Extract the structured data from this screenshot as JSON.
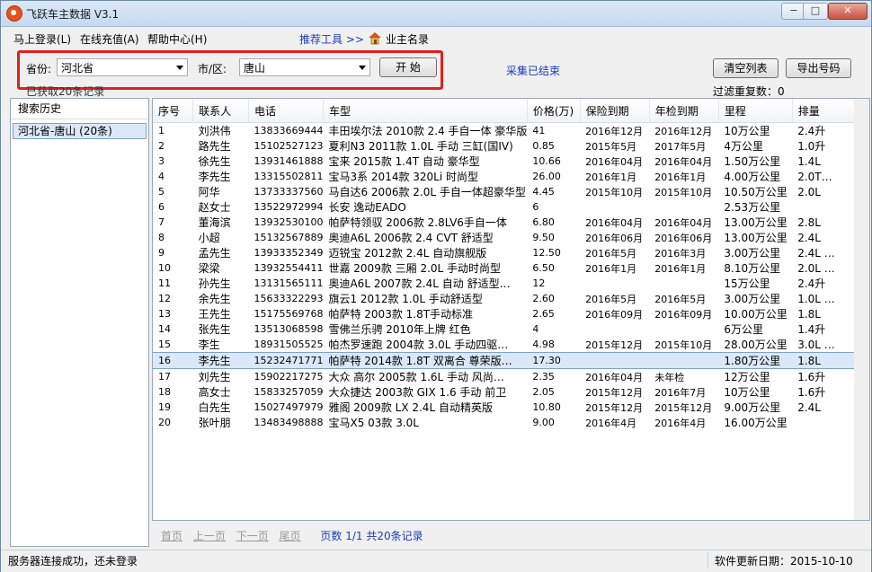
{
  "window": {
    "title": "飞跃车主数据 V3.1",
    "btn_min": "−",
    "btn_max": "□",
    "btn_close": "✕"
  },
  "menu": {
    "items": [
      "马上登录(L)",
      "在线充值(A)",
      "帮助中心(H)"
    ],
    "tools_link": "推荐工具 >>",
    "owners_list": "业主名录"
  },
  "filters": {
    "province_label": "省份:",
    "province_value": "河北省",
    "city_label": "市/区:",
    "city_value": "唐山",
    "start_button": "开 始",
    "collect_status": "采集已结束",
    "clear_button": "清空列表",
    "export_button": "导出号码",
    "got_records": "已获取20条记录",
    "dedup": "过滤重复数：0"
  },
  "sidebar": {
    "header": "搜索历史",
    "items": [
      "河北省-唐山 (20条)"
    ]
  },
  "table": {
    "columns": [
      "序号",
      "联系人",
      "电话",
      "车型",
      "价格(万)",
      "保险到期",
      "年检到期",
      "里程",
      "排量"
    ],
    "rows": [
      [
        "1",
        "刘洪伟",
        "13833669444",
        "丰田埃尔法 2010款 2.4 手自一体 豪华版",
        "41",
        "2016年12月",
        "2016年12月",
        "10万公里",
        "2.4升"
      ],
      [
        "2",
        "路先生",
        "15102527123",
        "夏利N3 2011款 1.0L 手动 三缸(国IV)",
        "0.85",
        "2015年5月",
        "2017年5月",
        "4万公里",
        "1.0升"
      ],
      [
        "3",
        "徐先生",
        "13931461888",
        "宝来 2015款 1.4T 自动 豪华型",
        "10.66",
        "2016年04月",
        "2016年04月",
        "1.50万公里",
        "1.4L"
      ],
      [
        "4",
        "李先生",
        "13315502811",
        "宝马3系 2014款 320Li 时尚型",
        "26.00",
        "2016年1月",
        "2016年1月",
        "4.00万公里",
        "2.0T…"
      ],
      [
        "5",
        "阿华",
        "13733337560",
        "马自达6 2006款 2.0L 手自一体超豪华型",
        "4.45",
        "2015年10月",
        "2015年10月",
        "10.50万公里",
        "2.0L"
      ],
      [
        "6",
        "赵女士",
        "13522972994",
        "长安 逸动EADO",
        "6",
        "",
        "",
        "2.53万公里",
        ""
      ],
      [
        "7",
        "董海滨",
        "13932530100",
        "帕萨特领驭 2006款 2.8LV6手自一体",
        "6.80",
        "2016年04月",
        "2016年04月",
        "13.00万公里",
        "2.8L"
      ],
      [
        "8",
        "小超",
        "15132567889",
        "奥迪A6L 2006款 2.4 CVT 舒适型",
        "9.50",
        "2016年06月",
        "2016年06月",
        "13.00万公里",
        "2.4L"
      ],
      [
        "9",
        "孟先生",
        "13933352349",
        "迈锐宝 2012款 2.4L 自动旗舰版",
        "12.50",
        "2016年5月",
        "2016年3月",
        "3.00万公里",
        "2.4L …"
      ],
      [
        "10",
        "梁梁",
        "13932554411",
        "世嘉 2009款 三厢 2.0L 手动时尚型",
        "6.50",
        "2016年1月",
        "2016年1月",
        "8.10万公里",
        "2.0L …"
      ],
      [
        "11",
        "孙先生",
        "13131565111",
        "奥迪A6L 2007款 2.4L 自动 舒适型…",
        "12",
        "",
        "",
        "15万公里",
        "2.4升"
      ],
      [
        "12",
        "余先生",
        "15633322293",
        "旗云1 2012款 1.0L 手动舒适型",
        "2.60",
        "2016年5月",
        "2016年5月",
        "3.00万公里",
        "1.0L …"
      ],
      [
        "13",
        "王先生",
        "15175569768",
        "帕萨特 2003款 1.8T手动标准",
        "2.65",
        "2016年09月",
        "2016年09月",
        "10.00万公里",
        "1.8L"
      ],
      [
        "14",
        "张先生",
        "13513068598",
        "雪佛兰乐骋 2010年上牌 红色",
        "4",
        "",
        "",
        "6万公里",
        "1.4升"
      ],
      [
        "15",
        "李生",
        "18931505525",
        "帕杰罗速跑 2004款 3.0L 手动四驱…",
        "4.98",
        "2015年12月",
        "2015年10月",
        "28.00万公里",
        "3.0L …"
      ],
      [
        "16",
        "李先生",
        "15232471771",
        "帕萨特 2014款 1.8T 双离合 尊荣版…",
        "17.30",
        "",
        "",
        "1.80万公里",
        "1.8L"
      ],
      [
        "17",
        "刘先生",
        "15902217275",
        "大众 高尔 2005款 1.6L 手动 风尚…",
        "2.35",
        "2016年04月",
        "未年检",
        "12万公里",
        "1.6升"
      ],
      [
        "18",
        "高女士",
        "15833257059",
        "大众捷达 2003款 GIX 1.6 手动 前卫",
        "2.05",
        "2015年12月",
        "2016年7月",
        "10万公里",
        "1.6升"
      ],
      [
        "19",
        "白先生",
        "15027497979",
        "雅阁 2009款 LX 2.4L 自动精英版",
        "10.80",
        "2015年12月",
        "2015年12月",
        "9.00万公里",
        "2.4L"
      ],
      [
        "20",
        "张叶朋",
        "13483498888",
        "宝马X5 03款 3.0L",
        "9.00",
        "2016年4月",
        "2016年4月",
        "16.00万公里",
        ""
      ]
    ],
    "selected_row": 16
  },
  "pager": {
    "first": "首页",
    "prev": "上一页",
    "next": "下一页",
    "last": "尾页",
    "info": "页数 1/1 共20条记录"
  },
  "status": {
    "left": "服务器连接成功，还未登录",
    "right": "软件更新日期：2015-10-10"
  },
  "colors": {
    "highlight_border": "#e41e1e",
    "link": "#1a3cb8",
    "selection": "#dbe8f9"
  }
}
